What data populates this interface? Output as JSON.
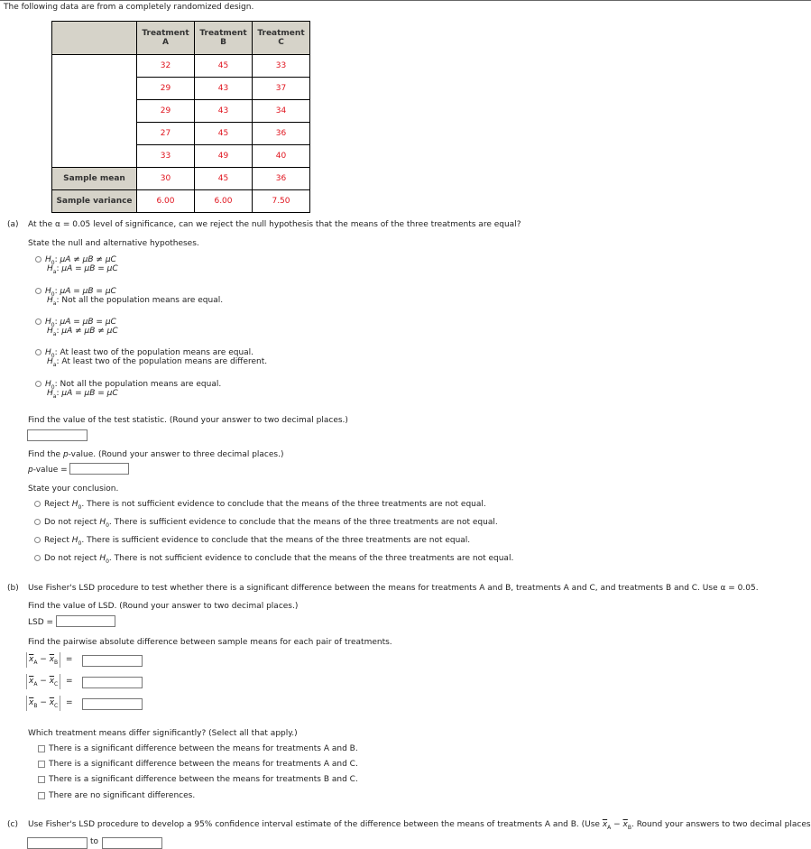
{
  "intro": "The following data are from a completely randomized design.",
  "table": {
    "headers": [
      {
        "line1": "Treatment",
        "line2": "A"
      },
      {
        "line1": "Treatment",
        "line2": "B"
      },
      {
        "line1": "Treatment",
        "line2": "C"
      }
    ],
    "rows": [
      [
        "32",
        "45",
        "33"
      ],
      [
        "29",
        "43",
        "37"
      ],
      [
        "29",
        "43",
        "34"
      ],
      [
        "27",
        "45",
        "36"
      ],
      [
        "33",
        "49",
        "40"
      ]
    ],
    "mean_label": "Sample mean",
    "means": [
      "30",
      "45",
      "36"
    ],
    "variance_label": "Sample variance",
    "variances": [
      "6.00",
      "6.00",
      "7.50"
    ],
    "value_color": "#e0141e"
  },
  "part_a": {
    "label": "(a)",
    "question": "At the α = 0.05 level of significance, can we reject the null hypothesis that the means of the three treatments are equal?",
    "hyp_prompt": "State the null and alternative hypotheses.",
    "hypotheses": [
      {
        "h0": "μA ≠ μB ≠ μC",
        "ha": "μA = μB = μC"
      },
      {
        "h0": "μA = μB = μC",
        "ha": "Not all the population means are equal."
      },
      {
        "h0": "μA = μB = μC",
        "ha": "μA ≠ μB ≠ μC"
      },
      {
        "h0": "At least two of the population means are equal.",
        "ha": "At least two of the population means are different."
      },
      {
        "h0": "Not all the population means are equal.",
        "ha": "μA = μB = μC"
      }
    ],
    "test_stat_prompt": "Find the value of the test statistic. (Round your answer to two decimal places.)",
    "test_stat_value": "",
    "pvalue_prompt_pre": "Find the ",
    "pvalue_prompt_p": "p",
    "pvalue_prompt_post": "-value. (Round your answer to three decimal places.)",
    "pvalue_label_p": "p",
    "pvalue_label_post": "-value =",
    "pvalue_value": "",
    "conclusion_prompt": "State your conclusion.",
    "conclusions": [
      {
        "pre": "Reject ",
        "post": ". There is not sufficient evidence to conclude that the means of the three treatments are not equal."
      },
      {
        "pre": "Do not reject ",
        "post": ". There is sufficient evidence to conclude that the means of the three treatments are not equal."
      },
      {
        "pre": "Reject ",
        "post": ". There is sufficient evidence to conclude that the means of the three treatments are not equal."
      },
      {
        "pre": "Do not reject ",
        "post": ". There is not sufficient evidence to conclude that the means of the three treatments are not equal."
      }
    ]
  },
  "part_b": {
    "label": "(b)",
    "question": "Use Fisher's LSD procedure to test whether there is a significant difference between the means for treatments A and B, treatments A and C, and treatments B and C. Use α = 0.05.",
    "lsd_prompt": "Find the value of LSD. (Round your answer to two decimal places.)",
    "lsd_label": "LSD =",
    "lsd_value": "",
    "pairwise_prompt": "Find the pairwise absolute difference between sample means for each pair of treatments.",
    "pairs": [
      {
        "a": "A",
        "b": "B",
        "value": ""
      },
      {
        "a": "A",
        "b": "C",
        "value": ""
      },
      {
        "a": "B",
        "b": "C",
        "value": ""
      }
    ],
    "differ_prompt": "Which treatment means differ significantly? (Select all that apply.)",
    "differ_options": [
      "There is a significant difference between the means for treatments A and B.",
      "There is a significant difference between the means for treatments A and C.",
      "There is a significant difference between the means for treatments B and C.",
      "There are no significant differences."
    ]
  },
  "part_c": {
    "label": "(c)",
    "question_pre": "Use Fisher's LSD procedure to develop a 95% confidence interval estimate of the difference between the means of treatments A and B. (Use ",
    "question_post": ". Round your answers to two decimal places.)",
    "to_label": "to",
    "lower_value": "",
    "upper_value": ""
  }
}
